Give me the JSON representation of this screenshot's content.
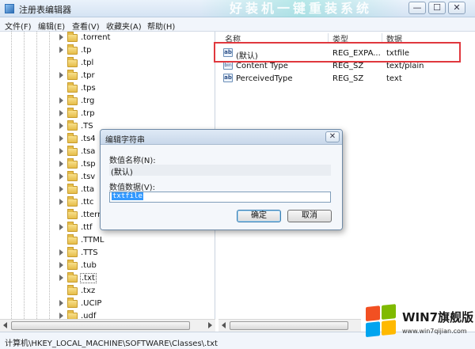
{
  "window": {
    "title": "注册表编辑器",
    "watermark_text": "好装机一键重装系统",
    "buttons": {
      "minimize": "—",
      "maximize": "☐",
      "close": "✕"
    }
  },
  "menu": [
    "文件(F)",
    "编辑(E)",
    "查看(V)",
    "收藏夹(A)",
    "帮助(H)"
  ],
  "tree": {
    "items": [
      ".torrent",
      ".tp",
      ".tpl",
      ".tpr",
      ".tps",
      ".trg",
      ".trp",
      ".TS",
      ".ts4",
      ".tsa",
      ".tsp",
      ".tsv",
      ".tta",
      ".ttc",
      ".ttern",
      ".ttf",
      ".TTML",
      ".TTS",
      ".tub",
      ".txt",
      ".txz",
      ".UCIP",
      ".udf"
    ],
    "selected": ".txt"
  },
  "list": {
    "columns": [
      "名称",
      "类型",
      "数据"
    ],
    "rows": [
      {
        "icon": "ab",
        "name": "(默认)",
        "type": "REG_EXPA...",
        "data": "txtfile"
      },
      {
        "icon": "bin",
        "name": "Content Type",
        "type": "REG_SZ",
        "data": "text/plain"
      },
      {
        "icon": "ab",
        "name": "PerceivedType",
        "type": "REG_SZ",
        "data": "text"
      }
    ]
  },
  "status": {
    "path": "计算机\\HKEY_LOCAL_MACHINE\\SOFTWARE\\Classes\\.txt"
  },
  "dialog": {
    "title": "编辑字符串",
    "close": "✕",
    "name_label": "数值名称(N):",
    "name_value": "(默认)",
    "data_label": "数值数据(V):",
    "data_value": "txtfile",
    "ok": "确定",
    "cancel": "取消"
  },
  "logo": {
    "title": "WIN7旗舰版",
    "url": "www.win7qijian.com"
  },
  "colors": {
    "highlight": "#e0383e",
    "selection": "#3399ff"
  }
}
